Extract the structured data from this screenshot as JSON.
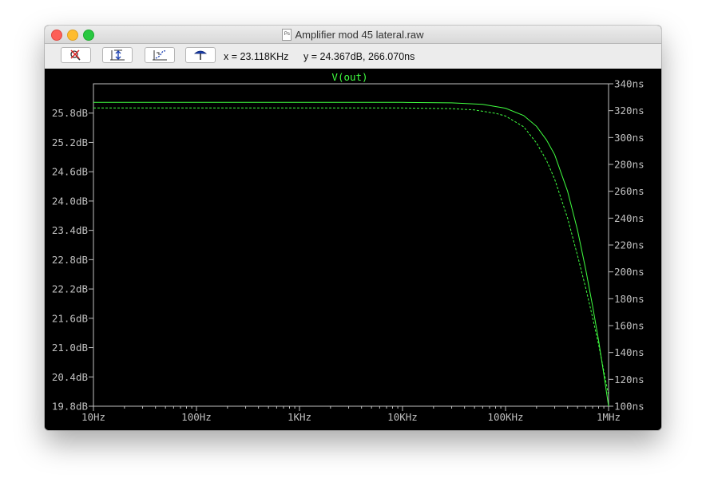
{
  "window": {
    "title": "Amplifier mod 45 lateral.raw",
    "file_badge": "Ps"
  },
  "toolbar": {
    "buttons": [
      "no-autoscale",
      "autoscale-y",
      "autoscale-x",
      "probe"
    ],
    "cursor_x_readout": "x = 23.118KHz",
    "cursor_y_readout": "y = 24.367dB, 266.070ns"
  },
  "colors": {
    "background": "#000000",
    "axis": "#c0c0c0",
    "trace": "#40ff40",
    "title": "#40ff40"
  },
  "chart_data": {
    "type": "line",
    "title": "V(out)",
    "x_scale": "log",
    "xlim": [
      10,
      1000000
    ],
    "x_ticks": [
      10,
      100,
      1000,
      10000,
      100000,
      1000000
    ],
    "x_tick_labels": [
      "10Hz",
      "100Hz",
      "1KHz",
      "10KHz",
      "100KHz",
      "1MHz"
    ],
    "y_left": {
      "unit": "dB",
      "ylim": [
        19.8,
        26.4
      ],
      "ticks": [
        19.8,
        20.4,
        21.0,
        21.6,
        22.2,
        22.8,
        23.4,
        24.0,
        24.6,
        25.2,
        25.8
      ],
      "tick_labels": [
        "19.8dB",
        "20.4dB",
        "21.0dB",
        "21.6dB",
        "22.2dB",
        "22.8dB",
        "23.4dB",
        "24.0dB",
        "24.6dB",
        "25.2dB",
        "25.8dB"
      ]
    },
    "y_right": {
      "unit": "ns",
      "ylim": [
        100,
        340
      ],
      "ticks": [
        100,
        120,
        140,
        160,
        180,
        200,
        220,
        240,
        260,
        280,
        300,
        320,
        340
      ],
      "tick_labels": [
        "100ns",
        "120ns",
        "140ns",
        "160ns",
        "180ns",
        "200ns",
        "220ns",
        "240ns",
        "260ns",
        "280ns",
        "300ns",
        "320ns",
        "340ns"
      ]
    },
    "grid": false,
    "series": [
      {
        "style": "solid",
        "axis": "left",
        "x": [
          10,
          1000,
          10000,
          30000,
          60000,
          100000,
          150000,
          200000,
          250000,
          300000,
          400000,
          500000,
          600000,
          700000,
          800000,
          900000,
          1000000
        ],
        "y": [
          26.02,
          26.02,
          26.02,
          26.01,
          25.98,
          25.9,
          25.75,
          25.53,
          25.25,
          24.95,
          24.2,
          23.4,
          22.6,
          21.85,
          21.15,
          20.45,
          19.8
        ]
      },
      {
        "style": "dashed",
        "axis": "right",
        "x": [
          10,
          1000,
          10000,
          30000,
          50000,
          80000,
          100000,
          150000,
          200000,
          250000,
          300000,
          400000,
          500000,
          600000,
          700000,
          800000,
          900000,
          1000000
        ],
        "y": [
          322,
          322,
          322,
          321.5,
          320.5,
          318,
          316,
          308,
          296,
          283,
          269,
          240,
          212,
          188,
          166,
          146,
          126,
          108
        ]
      }
    ]
  }
}
